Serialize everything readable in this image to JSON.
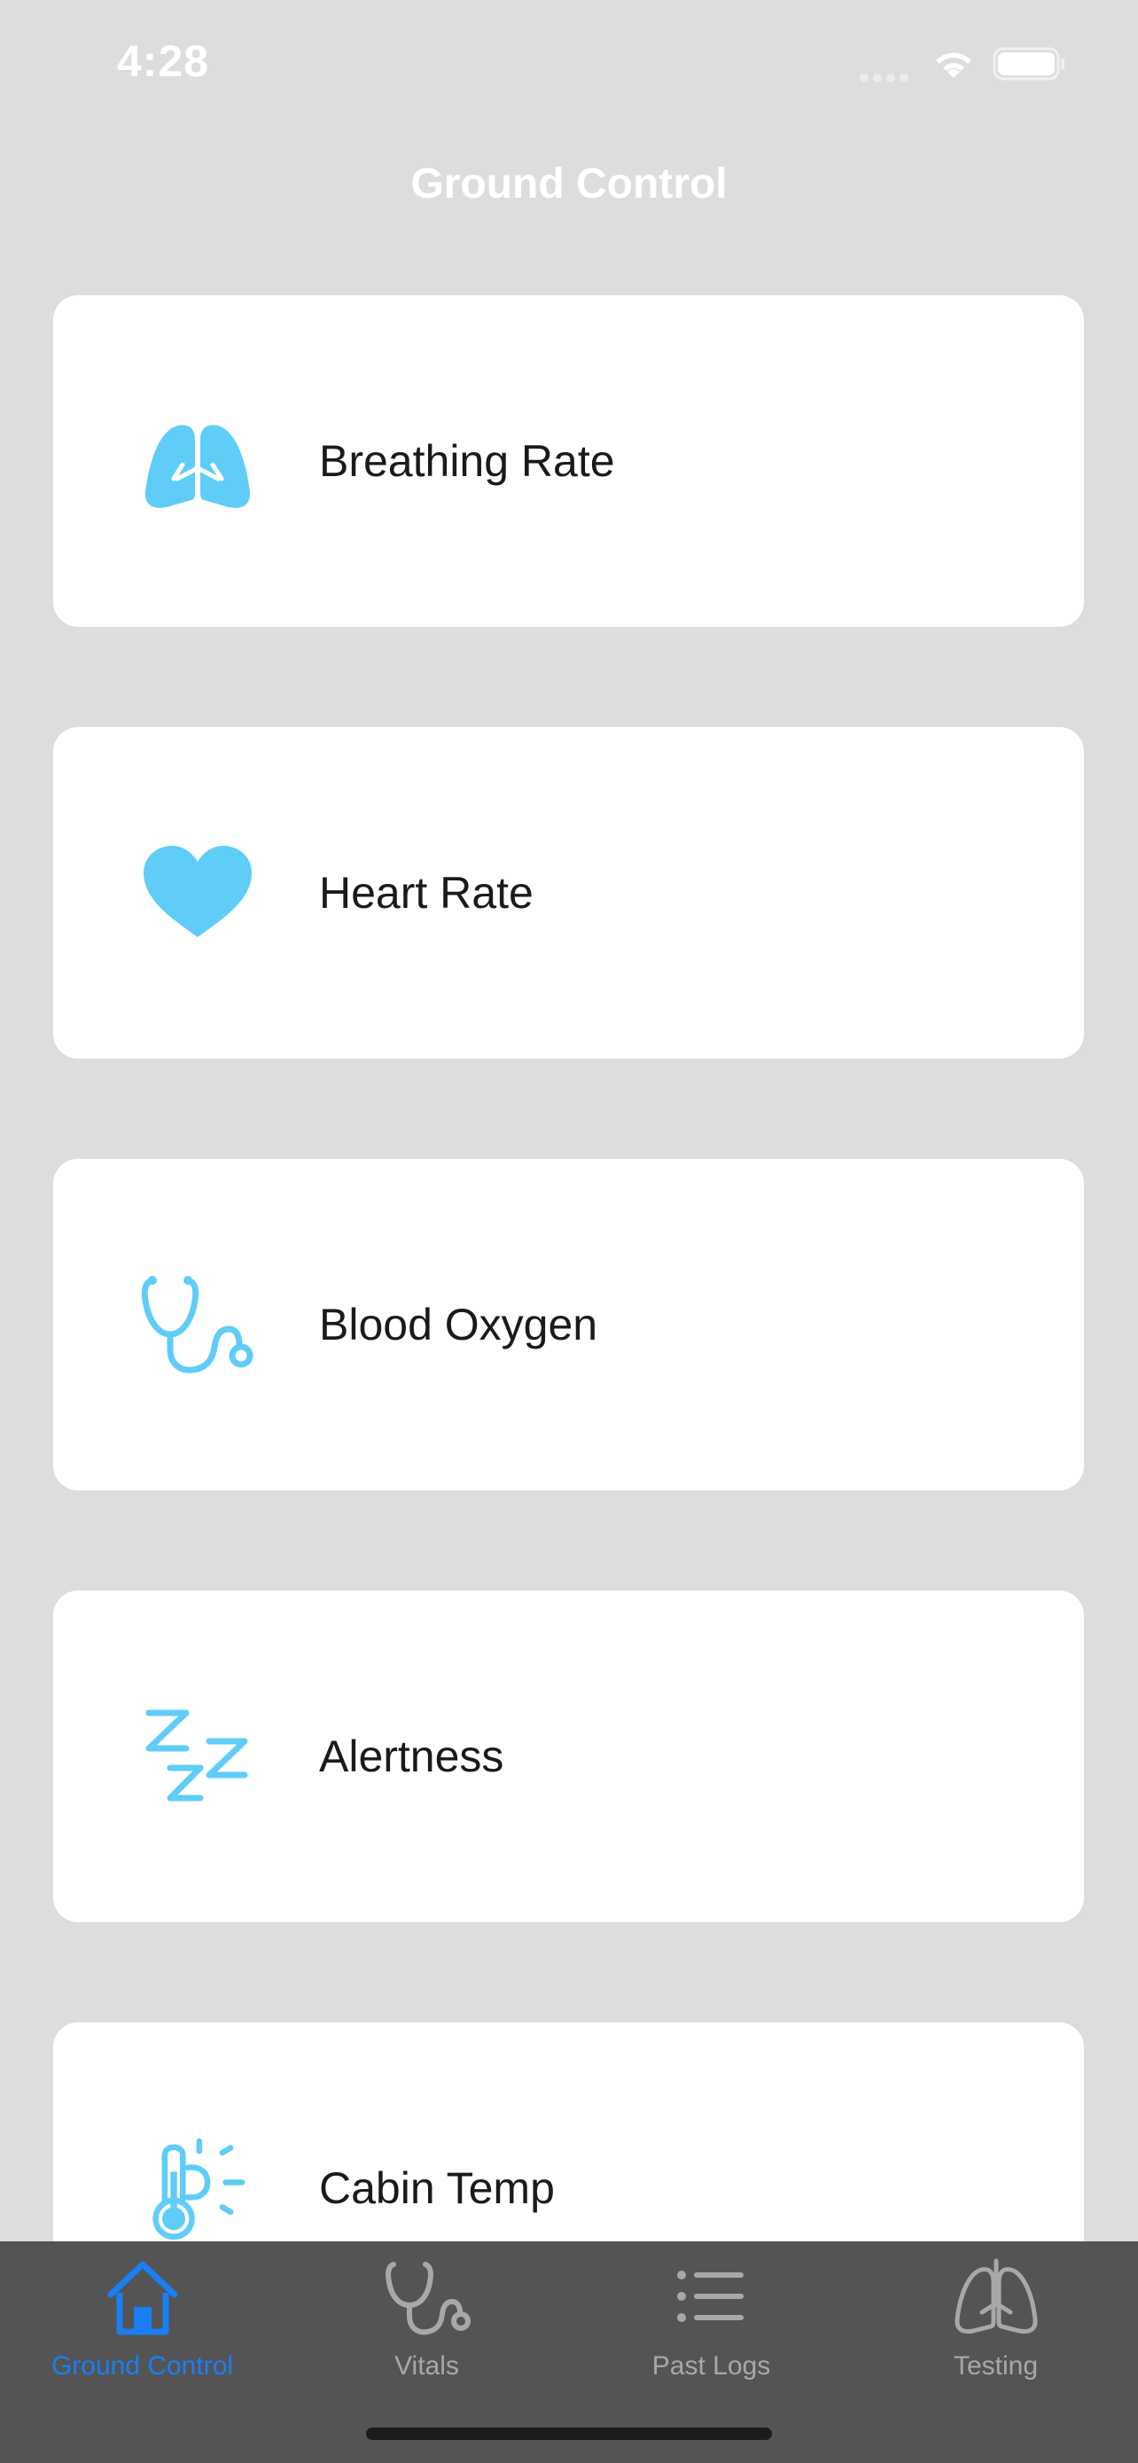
{
  "status_bar": {
    "time": "4:28"
  },
  "nav": {
    "title": "Ground Control"
  },
  "accent_color": "#1a7ef5",
  "icon_color": "#5fcdf8",
  "cards": [
    {
      "label": "Breathing Rate",
      "icon": "lungs-icon"
    },
    {
      "label": "Heart Rate",
      "icon": "heart-icon"
    },
    {
      "label": "Blood Oxygen",
      "icon": "stethoscope-icon"
    },
    {
      "label": "Alertness",
      "icon": "zzz-icon"
    },
    {
      "label": "Cabin Temp",
      "icon": "thermometer-sun-icon"
    }
  ],
  "tabs": [
    {
      "label": "Ground Control",
      "icon": "house-icon",
      "active": true
    },
    {
      "label": "Vitals",
      "icon": "stethoscope-icon",
      "active": false
    },
    {
      "label": "Past Logs",
      "icon": "list-icon",
      "active": false
    },
    {
      "label": "Testing",
      "icon": "lungs-icon",
      "active": false
    }
  ]
}
